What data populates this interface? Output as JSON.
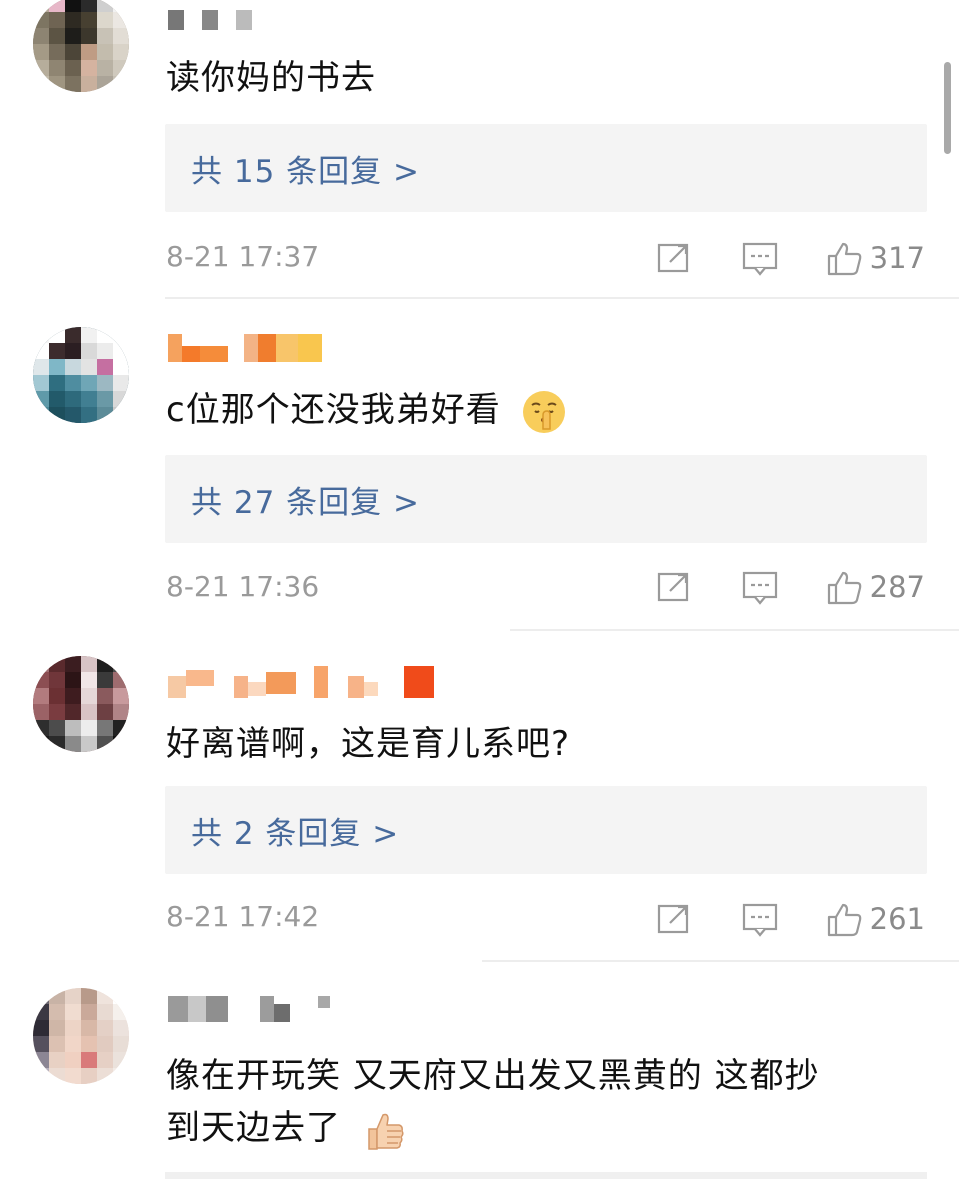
{
  "comments": [
    {
      "text": "读你妈的书去",
      "reply_link": "共 15 条回复 >",
      "time": "8-21 17:37",
      "likes": "317"
    },
    {
      "text": "c位那个还没我弟好看",
      "reply_link": "共 27 条回复 >",
      "time": "8-21 17:36",
      "likes": "287"
    },
    {
      "text": "好离谱啊，这是育儿系吧?",
      "reply_link": "共 2 条回复 >",
      "time": "8-21 17:42",
      "likes": "261"
    },
    {
      "text_line1": "像在开玩笑 又天府又出发又黑黄的 这都抄",
      "text_line2": "到天边去了"
    }
  ],
  "icons": {
    "share": "share-icon",
    "comment": "comment-icon",
    "like": "thumb-up-icon",
    "emoji_shush": "shushing-face-emoji",
    "emoji_thumb": "thumbs-up-emoji"
  },
  "colors": {
    "reply_link": "#476a9c",
    "meta_text": "#9a9a9a",
    "reply_bg": "#f4f4f4",
    "username_blur": "#f59a3c"
  }
}
